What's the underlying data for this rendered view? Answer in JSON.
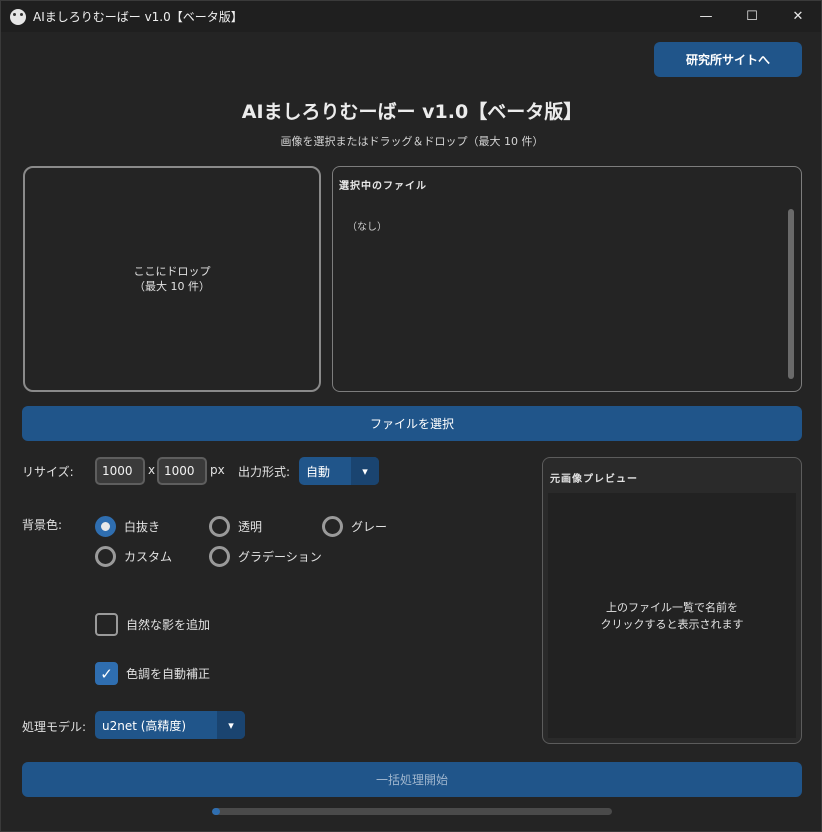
{
  "window": {
    "title": "AIましろりむーばー v1.0【ベータ版】",
    "controls": {
      "minimize": "—",
      "maximize": "☐",
      "close": "✕"
    }
  },
  "header": {
    "lab_button_label": "研究所サイトへ",
    "title": "AIましろりむーばー v1.0【ベータ版】",
    "subtitle": "画像を選択またはドラッグ＆ドロップ（最大 10 件）"
  },
  "drop_zone": {
    "line1": "ここにドロップ",
    "line2": "（最大 10 件）"
  },
  "file_list": {
    "title": "選択中のファイル",
    "empty_text": "（なし）"
  },
  "select_file_button": "ファイルを選択",
  "resize": {
    "label": "リサイズ:",
    "width": "1000",
    "separator": "x",
    "height": "1000",
    "unit": "px"
  },
  "output_format": {
    "label": "出力形式:",
    "selected": "自動"
  },
  "background": {
    "label": "背景色:",
    "options": [
      "白抜き",
      "透明",
      "グレー",
      "カスタム",
      "グラデーション"
    ],
    "selected": "白抜き"
  },
  "options": {
    "shadow_label": "自然な影を追加",
    "shadow_checked": false,
    "color_correct_label": "色調を自動補正",
    "color_correct_checked": true
  },
  "model": {
    "label": "処理モデル:",
    "selected": "u2net (高精度)"
  },
  "preview": {
    "title": "元画像プレビュー",
    "line1": "上のファイル一覧で名前を",
    "line2": "クリックすると表示されます"
  },
  "start_button": "一括処理開始",
  "progress": {
    "value": 0.02
  },
  "colors": {
    "accent": "#20558a",
    "radio_selected": "#2f6eb0",
    "background": "#242424"
  },
  "icons": {
    "app": "panda-icon",
    "dropdown": "chevron-down-icon",
    "check": "checkmark-icon"
  }
}
